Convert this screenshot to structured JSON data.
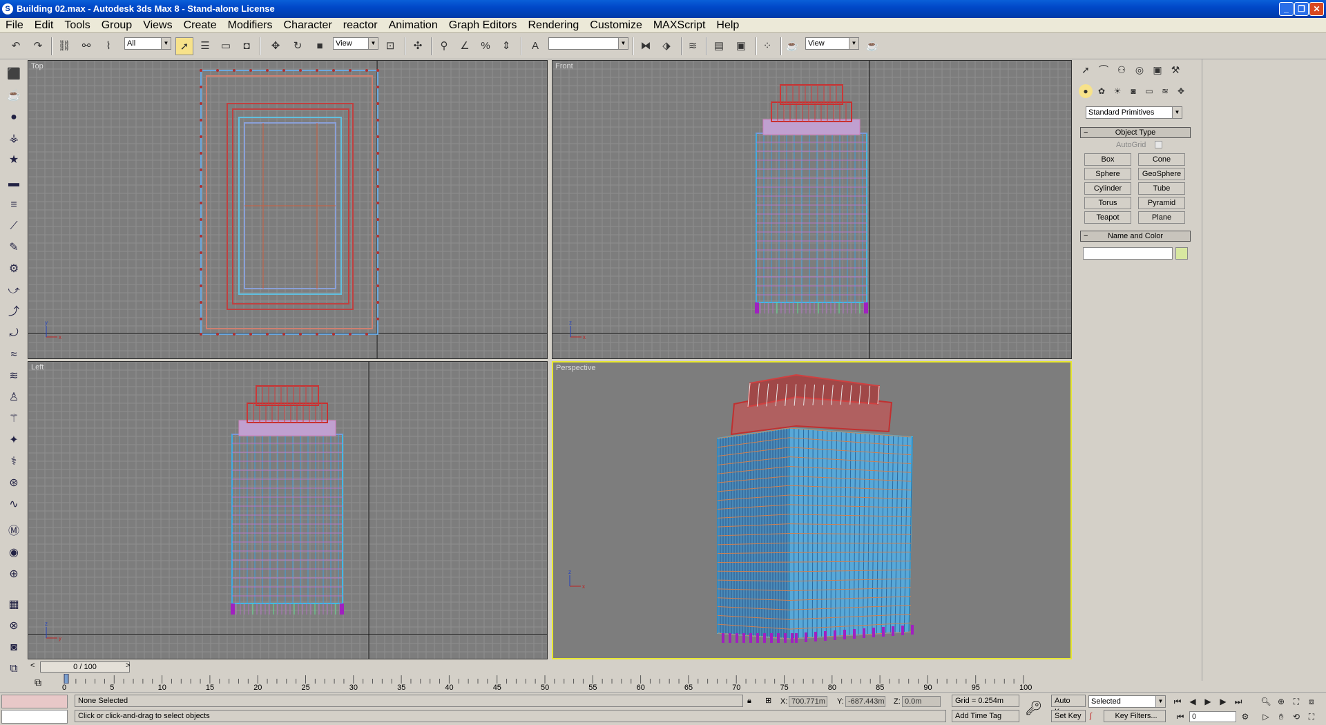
{
  "window": {
    "title": "Building 02.max - Autodesk 3ds Max 8  - Stand-alone License",
    "minimize": "_",
    "maximize": "❐",
    "close": "✕"
  },
  "menu": [
    "File",
    "Edit",
    "Tools",
    "Group",
    "Views",
    "Create",
    "Modifiers",
    "Character",
    "reactor",
    "Animation",
    "Graph Editors",
    "Rendering",
    "Customize",
    "MAXScript",
    "Help"
  ],
  "toolbar": {
    "selection_filter": "All",
    "ref_coord": "View",
    "named_selection": "",
    "render_view": "View"
  },
  "viewports": {
    "top": "Top",
    "front": "Front",
    "left": "Left",
    "perspective": "Perspective"
  },
  "command_panel": {
    "category": "Standard Primitives",
    "object_type": {
      "header": "Object Type",
      "autogrid": "AutoGrid",
      "buttons": [
        "Box",
        "Cone",
        "Sphere",
        "GeoSphere",
        "Cylinder",
        "Tube",
        "Torus",
        "Pyramid",
        "Teapot",
        "Plane"
      ]
    },
    "name_and_color": {
      "header": "Name and Color",
      "name": ""
    },
    "accent_color": "#d8e8a0"
  },
  "time_slider": {
    "label": "0 / 100"
  },
  "track_ruler": {
    "ticks": [
      "0",
      "5",
      "10",
      "15",
      "20",
      "25",
      "30",
      "35",
      "40",
      "45",
      "50",
      "55",
      "60",
      "65",
      "70",
      "75",
      "80",
      "85",
      "90",
      "95",
      "100"
    ]
  },
  "status": {
    "selection": "None Selected",
    "prompt": "Click or click-and-drag to select objects",
    "x": "700.771m",
    "y": "-687.443m",
    "z": "0.0m",
    "grid": "Grid = 0.254m",
    "add_time_tag": "Add Time Tag",
    "auto_key": "Auto Key",
    "set_key": "Set Key",
    "key_mode": "Selected",
    "key_filters": "Key Filters...",
    "frame": "0"
  }
}
